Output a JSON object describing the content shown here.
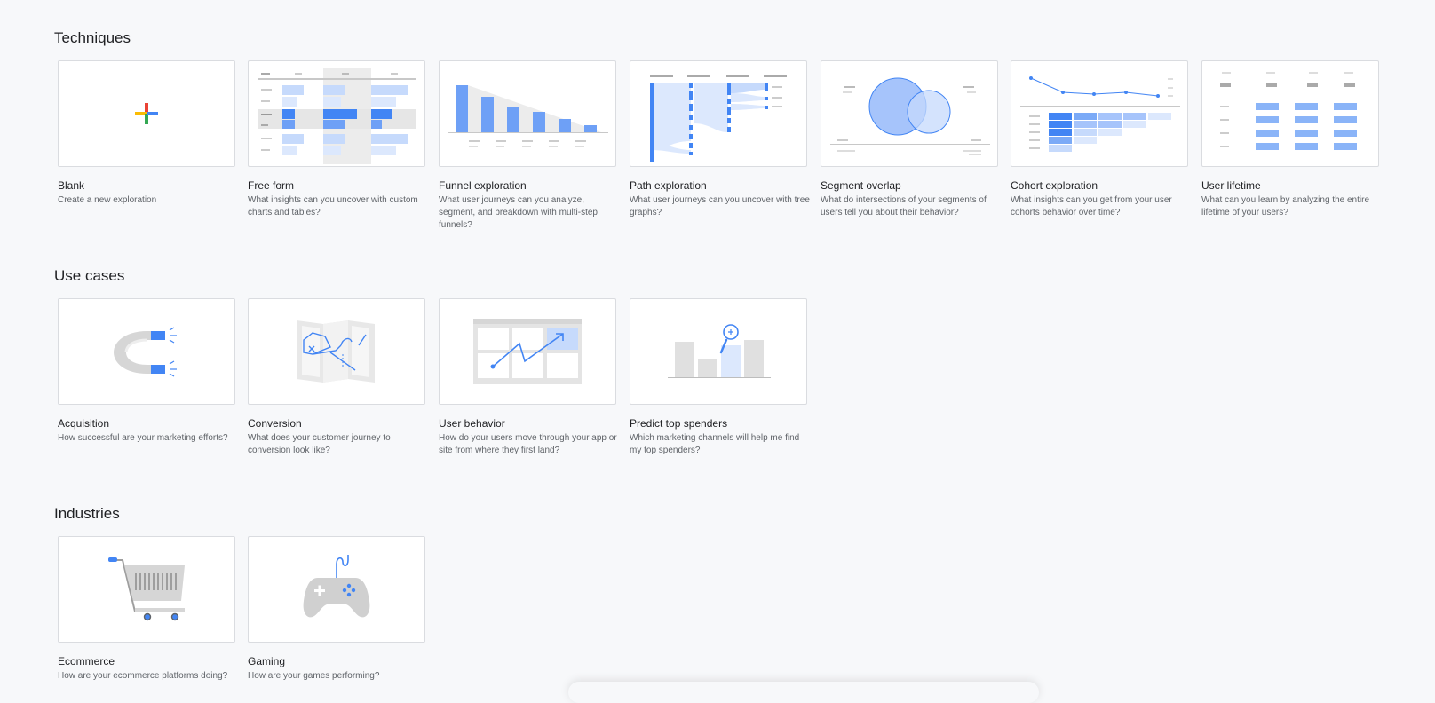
{
  "sections": {
    "techniques": {
      "title": "Techniques",
      "cards": [
        {
          "title": "Blank",
          "desc": "Create a new exploration",
          "icon": "plus-icon"
        },
        {
          "title": "Free form",
          "desc": "What insights can you uncover with custom charts and tables?",
          "icon": "table-chart-icon"
        },
        {
          "title": "Funnel exploration",
          "desc": "What user journeys can you analyze, segment, and breakdown with multi-step funnels?",
          "icon": "funnel-chart-icon"
        },
        {
          "title": "Path exploration",
          "desc": "What user journeys can you uncover with tree graphs?",
          "icon": "path-tree-icon"
        },
        {
          "title": "Segment overlap",
          "desc": "What do intersections of your segments of users tell you about their behavior?",
          "icon": "venn-diagram-icon"
        },
        {
          "title": "Cohort exploration",
          "desc": "What insights can you get from your user cohorts behavior over time?",
          "icon": "cohort-grid-icon"
        },
        {
          "title": "User lifetime",
          "desc": "What can you learn by analyzing the entire lifetime of your users?",
          "icon": "lifetime-table-icon"
        }
      ]
    },
    "use_cases": {
      "title": "Use cases",
      "cards": [
        {
          "title": "Acquisition",
          "desc": "How successful are your marketing efforts?",
          "icon": "magnet-icon"
        },
        {
          "title": "Conversion",
          "desc": "What does your customer journey to conversion look like?",
          "icon": "map-icon"
        },
        {
          "title": "User behavior",
          "desc": "How do your users move through your app or site from where they first land?",
          "icon": "trend-arrow-icon"
        },
        {
          "title": "Predict top spenders",
          "desc": "Which marketing channels will help me find my top spenders?",
          "icon": "spender-bars-icon"
        }
      ]
    },
    "industries": {
      "title": "Industries",
      "cards": [
        {
          "title": "Ecommerce",
          "desc": "How are your ecommerce platforms doing?",
          "icon": "shopping-cart-icon"
        },
        {
          "title": "Gaming",
          "desc": "How are your games performing?",
          "icon": "gamepad-icon"
        }
      ]
    }
  },
  "colors": {
    "accent": "#4285f4",
    "light_accent": "#aecbfa",
    "google_red": "#ea4335",
    "google_yellow": "#fbbc04",
    "google_green": "#34a853",
    "google_blue": "#4285f4"
  }
}
